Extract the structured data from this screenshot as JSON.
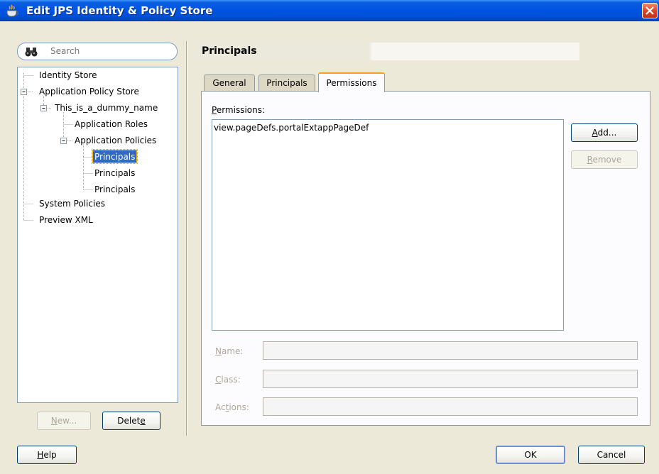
{
  "window": {
    "title": "Edit JPS Identity & Policy Store"
  },
  "search": {
    "placeholder": "Search"
  },
  "tree": {
    "identity_store": "Identity Store",
    "application_policy_store": "Application Policy Store",
    "dummy_name": "This_is_a_dummy_name",
    "application_roles": "Application Roles",
    "application_policies": "Application Policies",
    "principals_1": "Principals",
    "principals_2": "Principals",
    "principals_3": "Principals",
    "system_policies": "System Policies",
    "preview_xml": "Preview XML"
  },
  "left_buttons": {
    "new_label_mnemonic": "N",
    "new_label_rest": "ew...",
    "delete_label_pre": "Delet",
    "delete_label_mnemonic": "e"
  },
  "section_title": "Principals",
  "tabs": {
    "general": "General",
    "principals": "Principals",
    "permissions": "Permissions"
  },
  "permissions": {
    "label_mnemonic": "P",
    "label_rest": "ermissions:",
    "items": [
      "view.pageDefs.portalExtappPageDef"
    ],
    "add_mnemonic": "A",
    "add_rest": "dd...",
    "remove_mnemonic": "R",
    "remove_rest": "emove"
  },
  "fields": {
    "name_mnemonic": "N",
    "name_rest": "ame:",
    "class_mnemonic": "C",
    "class_rest": "lass:",
    "actions_pre": "Ac",
    "actions_mnemonic": "t",
    "actions_rest": "ions:",
    "name_value": "",
    "class_value": "",
    "actions_value": ""
  },
  "footer": {
    "help_mnemonic": "H",
    "help_rest": "elp",
    "ok_label": "OK",
    "cancel_label": "Cancel"
  },
  "colors": {
    "titlebar": "#0054e3",
    "selection": "#316ac5",
    "window_bg": "#ece9d8",
    "active_tab_accent": "#f1a028"
  }
}
